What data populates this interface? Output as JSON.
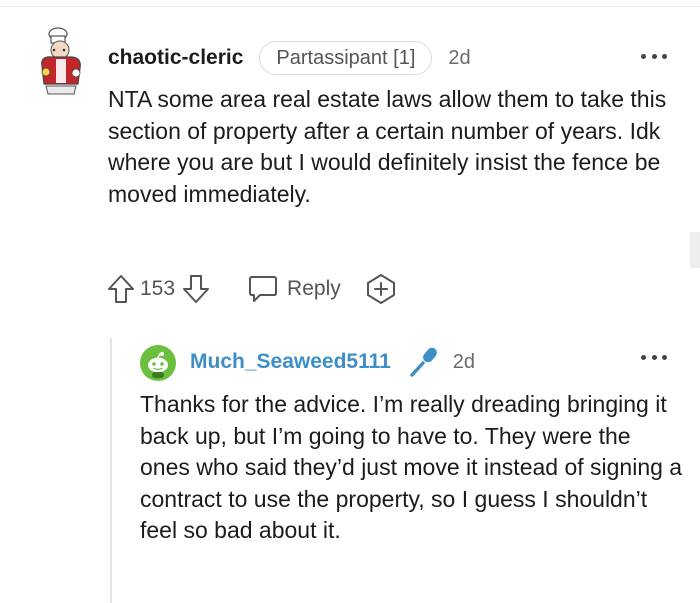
{
  "comment": {
    "username": "chaotic-cleric",
    "flair": "Partassipant [1]",
    "time": "2d",
    "body": "NTA some area real estate laws allow them to take this section of property after a certain number of years. Idk where you are but I would definitely insist the fence be moved immediately.",
    "score": "153",
    "reply_label": "Reply"
  },
  "reply": {
    "username": "Much_Seaweed5111",
    "time": "2d",
    "body": "Thanks for the advice. I’m really dreading bringing it back up, but I’m going to have to. They were the ones who said they’d just move it instead of signing a contract to use the property, so I guess I shouldn’t feel so bad about it."
  },
  "colors": {
    "username_reply": "#3d8fc6",
    "mic_icon": "#3d8fc6",
    "avatar_reply": "#6bbf3e",
    "avatar_op": "#c0262a",
    "text": "#1c1c1c",
    "meta": "#6b6b6b"
  },
  "icons": {
    "upvote": "upvote-arrow-icon",
    "downvote": "downvote-arrow-icon",
    "reply": "speech-bubble-icon",
    "award": "award-plus-icon",
    "mic": "microphone-icon",
    "more": "three-dots-icon"
  }
}
